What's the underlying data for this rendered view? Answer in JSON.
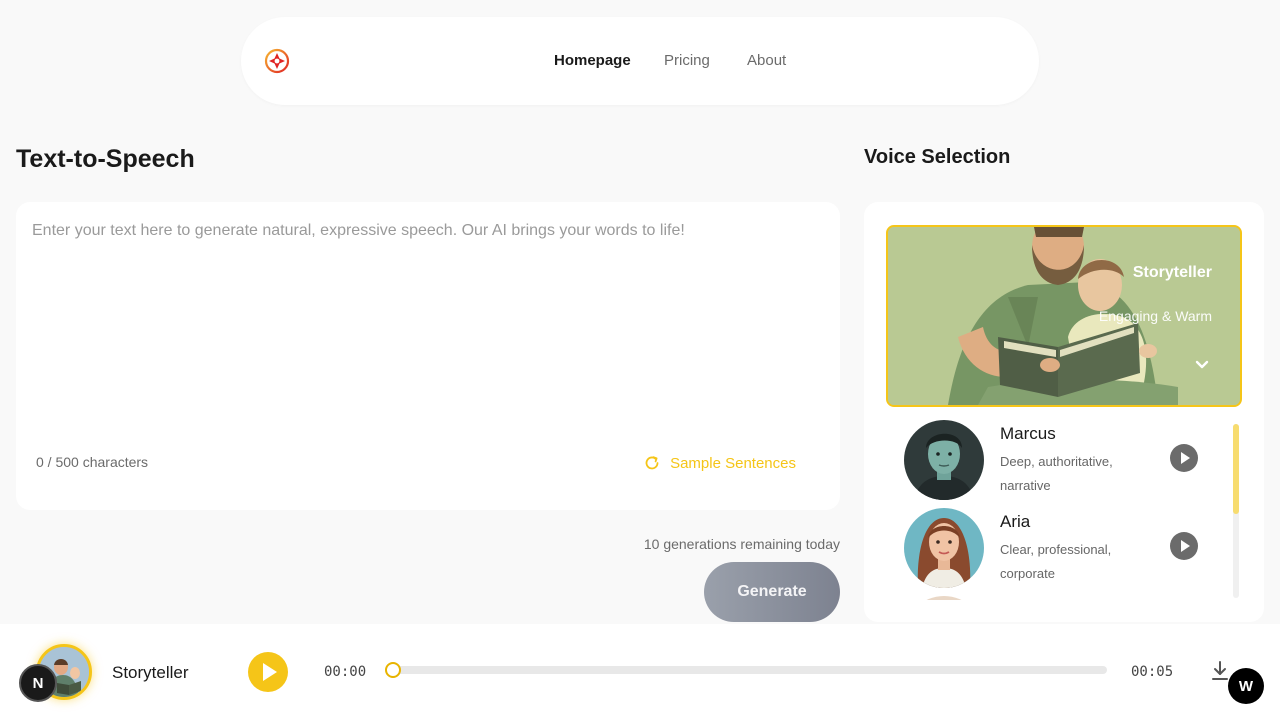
{
  "nav": {
    "links": [
      {
        "label": "Homepage",
        "active": true
      },
      {
        "label": "Pricing",
        "active": false
      },
      {
        "label": "About",
        "active": false
      }
    ]
  },
  "tts": {
    "title": "Text-to-Speech",
    "placeholder": "Enter your text here to generate natural, expressive speech. Our AI brings your words to life!",
    "value": "",
    "char_count": "0 / 500 characters",
    "sample_label": "Sample Sentences",
    "generations_remaining": "10 generations remaining today",
    "generate_label": "Generate"
  },
  "voices": {
    "title": "Voice Selection",
    "featured": {
      "name": "Storyteller",
      "description": "Engaging & Warm"
    },
    "list": [
      {
        "name": "Marcus",
        "description": "Deep, authoritative, narrative"
      },
      {
        "name": "Aria",
        "description": "Clear, professional, corporate"
      }
    ]
  },
  "player": {
    "voice_name": "Storyteller",
    "current_time": "00:00",
    "duration": "00:05",
    "progress": 0
  },
  "badges": {
    "left": "N",
    "right": "W"
  },
  "colors": {
    "accent": "#f5c518",
    "button_gray": "#8a8f9b"
  }
}
